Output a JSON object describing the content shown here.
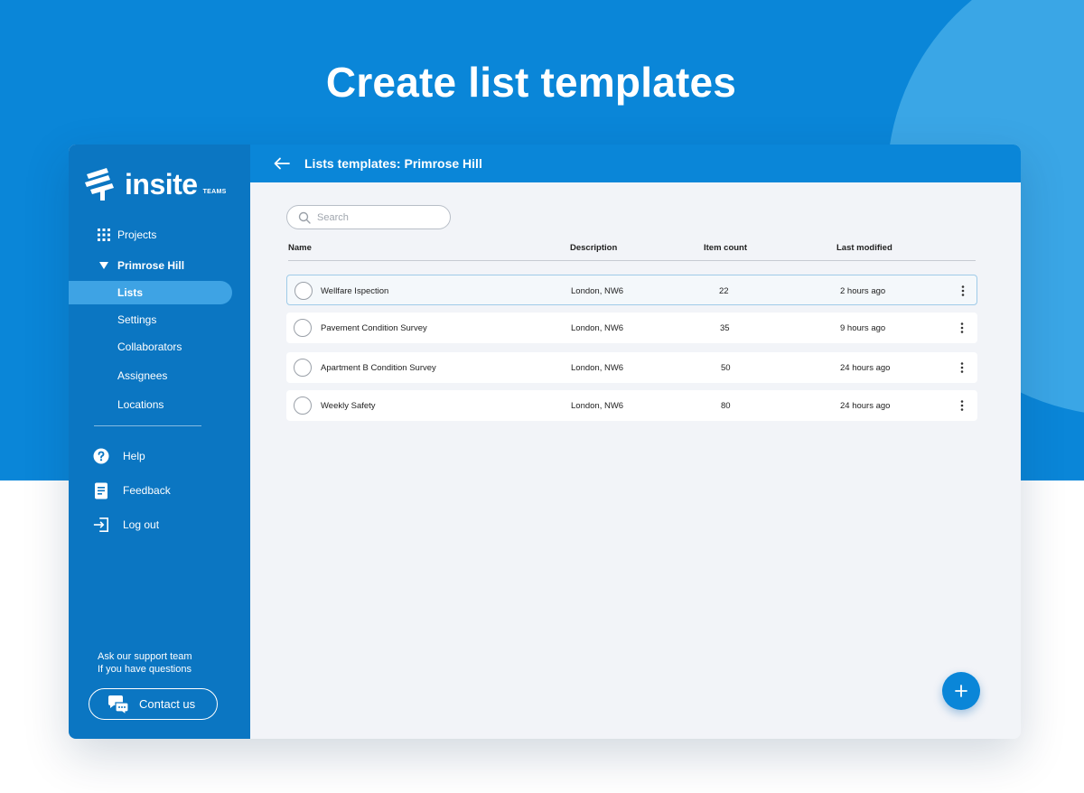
{
  "hero": {
    "title": "Create list templates"
  },
  "brand": {
    "name": "insite",
    "sub": "TEAMS"
  },
  "sidebar": {
    "projects": "Projects",
    "project_name": "Primrose Hill",
    "items": [
      "Lists",
      "Settings",
      "Collaborators",
      "Assignees",
      "Locations"
    ],
    "utils": [
      "Help",
      "Feedback",
      "Log out"
    ],
    "support_line1": "Ask our support team",
    "support_line2": "If you have questions",
    "contact": "Contact us"
  },
  "header": {
    "title": "Lists templates: Primrose Hill"
  },
  "search": {
    "placeholder": "Search"
  },
  "table": {
    "columns": [
      "Name",
      "Description",
      "Item count",
      "Last modified"
    ],
    "rows": [
      {
        "name": "Wellfare Ispection",
        "description": "London, NW6",
        "count": "22",
        "modified": "2 hours ago"
      },
      {
        "name": "Pavement Condition Survey",
        "description": "London, NW6",
        "count": "35",
        "modified": "9 hours ago"
      },
      {
        "name": "Apartment B Condition Survey",
        "description": "London, NW6",
        "count": "50",
        "modified": "24 hours ago"
      },
      {
        "name": "Weekly Safety",
        "description": "London, NW6",
        "count": "80",
        "modified": "24 hours ago"
      }
    ]
  },
  "colors": {
    "primary": "#0a86d8",
    "sidebar": "#0b76c2",
    "active": "#3ea3e4",
    "background": "#f2f4f8"
  },
  "icons": [
    "grid-icon",
    "caret-down-icon",
    "help-icon",
    "feedback-icon",
    "logout-icon",
    "chat-icon",
    "back-arrow-icon",
    "search-icon",
    "more-vertical-icon",
    "plus-icon"
  ]
}
